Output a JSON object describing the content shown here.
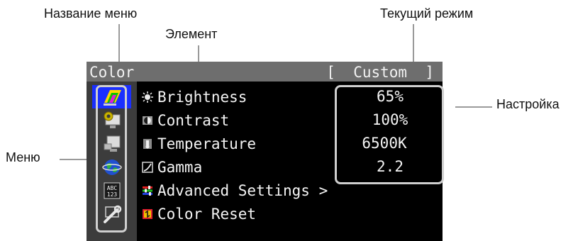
{
  "callouts": {
    "menu_name": "Название меню",
    "element": "Элемент",
    "current_mode": "Текущий режим",
    "settings": "Настройка",
    "menu": "Меню"
  },
  "osd": {
    "title": "Color",
    "mode": "[  Custom  ]",
    "sidebar": [
      {
        "icon": "color-monitor-icon",
        "active": true
      },
      {
        "icon": "screen-settings-icon",
        "active": false
      },
      {
        "icon": "power-monitor-icon",
        "active": false
      },
      {
        "icon": "language-globe-icon",
        "active": false
      },
      {
        "icon": "abc-123-text-icon",
        "active": false
      },
      {
        "icon": "tools-wrench-icon",
        "active": false
      }
    ],
    "items": [
      {
        "icon": "brightness-sun-icon",
        "label": "Brightness",
        "value": "65%"
      },
      {
        "icon": "contrast-icon",
        "label": "Contrast",
        "value": "100%"
      },
      {
        "icon": "thermometer-icon",
        "label": "Temperature",
        "value": "6500K"
      },
      {
        "icon": "gamma-icon",
        "label": "Gamma",
        "value": "2.2"
      },
      {
        "icon": "advanced-settings-icon",
        "label": "Advanced Settings >"
      },
      {
        "icon": "color-reset-icon",
        "label": "Color Reset"
      }
    ]
  },
  "colors": {
    "titlebar": "#6e6e6e",
    "sidebar": "#3c3c3c",
    "active_highlight": "#1a2fff",
    "frame": "#cfcfcf"
  }
}
